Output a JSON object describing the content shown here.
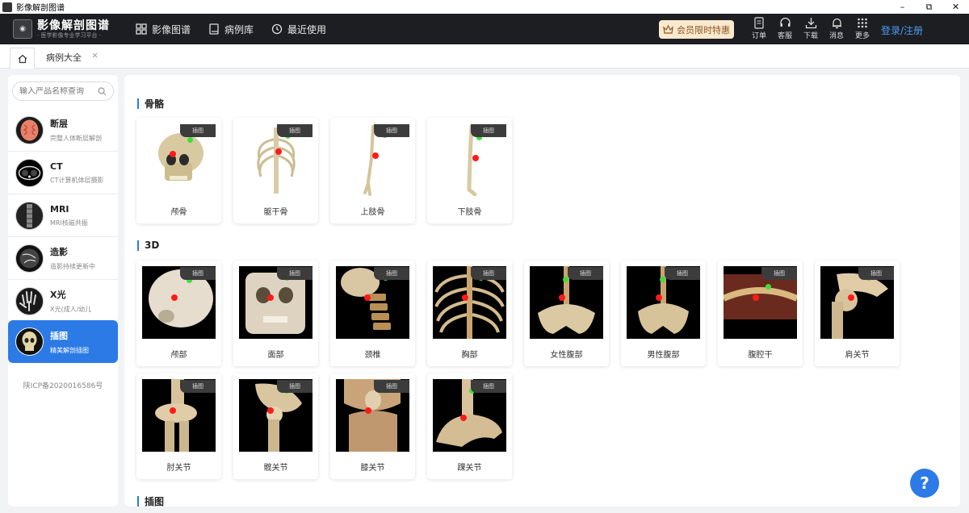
{
  "window": {
    "title": "影像解剖图谱",
    "btn_min": "–",
    "btn_max": "⧉",
    "btn_close": "✕"
  },
  "header": {
    "logo_title": "影像解剖图谱",
    "logo_sub": "· 医学影像专业学习平台 ·",
    "nav": [
      {
        "label": "影像图谱",
        "icon": "grid-icon"
      },
      {
        "label": "病例库",
        "icon": "book-icon"
      },
      {
        "label": "最近使用",
        "icon": "history-icon"
      }
    ],
    "vip": "会员限时特惠",
    "tools": [
      {
        "label": "订单",
        "icon": "order-icon"
      },
      {
        "label": "客服",
        "icon": "headset-icon"
      },
      {
        "label": "下载",
        "icon": "download-icon"
      },
      {
        "label": "消息",
        "icon": "bell-icon"
      },
      {
        "label": "更多",
        "icon": "more-icon"
      }
    ],
    "login": "登录/注册"
  },
  "tabs": {
    "active": "病例大全",
    "close": "×"
  },
  "sidebar": {
    "search_placeholder": "输入产品名称查询",
    "items": [
      {
        "name": "断层",
        "desc": "完整人体断层解剖"
      },
      {
        "name": "CT",
        "desc": "CT计算机体层摄影"
      },
      {
        "name": "MRI",
        "desc": "MRI核磁共振"
      },
      {
        "name": "造影",
        "desc": "造影持续更新中"
      },
      {
        "name": "X光",
        "desc": "X光(成人/幼儿"
      },
      {
        "name": "插图",
        "desc": "精美解剖插图"
      }
    ],
    "icp": "陕ICP备2020016586号"
  },
  "main": {
    "tag": "插图",
    "sections": [
      {
        "title": "骨骼",
        "cards": [
          "颅骨",
          "躯干骨",
          "上肢骨",
          "下肢骨"
        ]
      },
      {
        "title": "3D",
        "cards": [
          "颅部",
          "面部",
          "颈椎",
          "胸部",
          "女性腹部",
          "男性腹部",
          "腹腔干",
          "肩关节",
          "肘关节",
          "髋关节",
          "膝关节",
          "踝关节"
        ]
      },
      {
        "title": "插图",
        "cards": []
      }
    ]
  },
  "help": "?"
}
